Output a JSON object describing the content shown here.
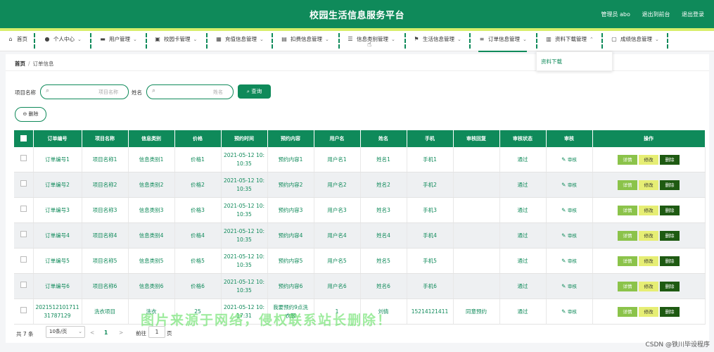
{
  "header": {
    "title": "校园生活信息服务平台",
    "admin": "管理员 abo",
    "front_link": "退出到前台",
    "logout": "退出登录"
  },
  "nav": {
    "items": [
      {
        "label": "首页",
        "icon": "home-icon"
      },
      {
        "label": "个人中心",
        "icon": "user-icon"
      },
      {
        "label": "用户管理",
        "icon": "users-icon"
      },
      {
        "label": "校园卡管理",
        "icon": "card-icon"
      },
      {
        "label": "充值信息管理",
        "icon": "grid-icon"
      },
      {
        "label": "扣费信息管理",
        "icon": "list-icon"
      },
      {
        "label": "信息类别管理",
        "icon": "sliders-icon"
      },
      {
        "label": "生活信息管理",
        "icon": "flag-icon"
      },
      {
        "label": "订单信息管理",
        "icon": "menu-icon"
      },
      {
        "label": "资料下载管理",
        "icon": "clipboard-icon"
      },
      {
        "label": "成绩信息管理",
        "icon": "doc-icon"
      }
    ],
    "dropdown_item": "资料下载"
  },
  "breadcrumb": {
    "home": "首页",
    "current": "订单信息"
  },
  "search": {
    "label1": "项目名称",
    "placeholder1": "项目名称",
    "label2": "姓名",
    "placeholder2": "姓名",
    "button": "查询"
  },
  "toolbar": {
    "delete_label": "删除"
  },
  "table": {
    "headers": [
      "订单编号",
      "项目名称",
      "信息类别",
      "价格",
      "预约时间",
      "预约内容",
      "用户名",
      "姓名",
      "手机",
      "审核回复",
      "审核状态",
      "审核",
      "操作"
    ],
    "rows": [
      [
        "订单编号1",
        "项目名称1",
        "信息类别1",
        "价格1",
        "2021-05-12 10:\n10:35",
        "预约内容1",
        "用户名1",
        "姓名1",
        "手机1",
        "",
        "通过",
        "审核"
      ],
      [
        "订单编号2",
        "项目名称2",
        "信息类别2",
        "价格2",
        "2021-05-12 10:\n10:35",
        "预约内容2",
        "用户名2",
        "姓名2",
        "手机2",
        "",
        "通过",
        "审核"
      ],
      [
        "订单编号3",
        "项目名称3",
        "信息类别3",
        "价格3",
        "2021-05-12 10:\n10:35",
        "预约内容3",
        "用户名3",
        "姓名3",
        "手机3",
        "",
        "通过",
        "审核"
      ],
      [
        "订单编号4",
        "项目名称4",
        "信息类别4",
        "价格4",
        "2021-05-12 10:\n10:35",
        "预约内容4",
        "用户名4",
        "姓名4",
        "手机4",
        "",
        "通过",
        "审核"
      ],
      [
        "订单编号5",
        "项目名称5",
        "信息类别5",
        "价格5",
        "2021-05-12 10:\n10:35",
        "预约内容5",
        "用户名5",
        "姓名5",
        "手机5",
        "",
        "通过",
        "审核"
      ],
      [
        "订单编号6",
        "项目名称6",
        "信息类别6",
        "价格6",
        "2021-05-12 10:\n10:35",
        "预约内容6",
        "用户名6",
        "姓名6",
        "手机6",
        "",
        "通过",
        "审核"
      ],
      [
        "2021512101711\n31787129",
        "洗衣项目",
        "洗衣",
        "25",
        "2021-05-12 10:\n17:31",
        "我要预约9点洗\n衣服",
        "1",
        "刘倩",
        "15214121411",
        "同意预约",
        "通过",
        "审核"
      ]
    ],
    "actions": {
      "detail": "详情",
      "edit": "修改",
      "delete": "删除"
    }
  },
  "pager": {
    "total": "共 7 条",
    "page_size": "10条/页",
    "prev": "<",
    "current": "1",
    "next": ">",
    "goto_label": "前往",
    "goto_value": "1",
    "page_unit": "页"
  },
  "overlay": {
    "watermark": "图片来源于网络，侵权联系站长删除！",
    "credit": "CSDN @铁川毕设程序"
  },
  "colors": {
    "primary": "#0f8a5a",
    "accent": "#d8ee6b",
    "detail": "#8bc34a",
    "edit": "#e6ee74",
    "delete": "#1e5a12"
  }
}
